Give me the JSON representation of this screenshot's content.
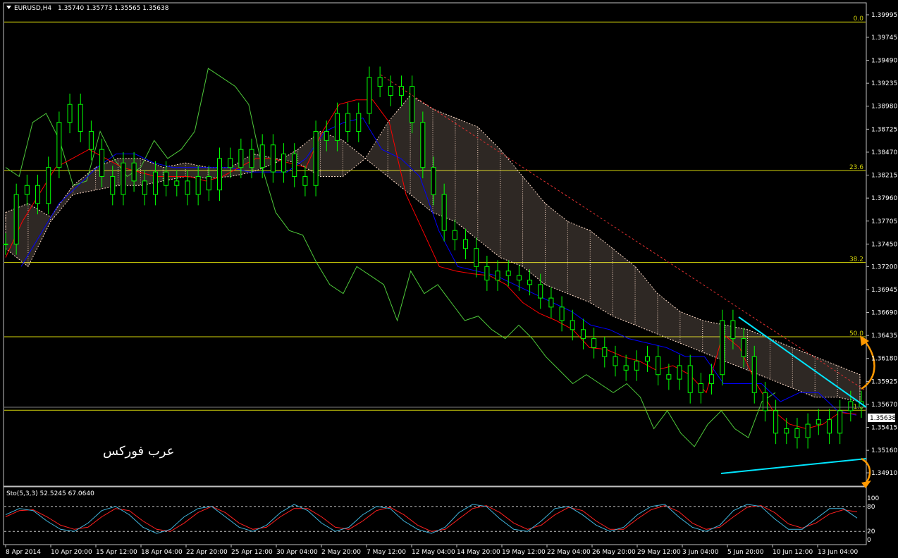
{
  "header": {
    "symbol_timeframe": "EURUSD,H4",
    "ohlc": "1.35740 1.35773 1.35565 1.35638"
  },
  "watermark": "عرب فوركس",
  "current_price_label": "1.35638",
  "colors": {
    "background": "#000000",
    "candles": "#00ff00",
    "tenkan": "#ff0000",
    "kijun": "#0000ff",
    "chikou": "#4ec93a",
    "cloud": "#ffdcc8",
    "fib": "#d4d40a",
    "trendline": "#00e5ff",
    "dashed_trend": "#e03030",
    "arrow": "#ff9900",
    "stoch_main": "#40b4dc",
    "stoch_signal": "#ff2020"
  },
  "chart_data": {
    "type": "line",
    "main_panel": {
      "ylim": [
        1.3477,
        1.4012
      ],
      "y_ticks": [
        "1.39995",
        "1.39745",
        "1.39490",
        "1.39235",
        "1.38980",
        "1.38725",
        "1.38470",
        "1.38215",
        "1.37960",
        "1.37705",
        "1.37450",
        "1.37200",
        "1.36945",
        "1.36690",
        "1.36435",
        "1.36180",
        "1.35925",
        "1.35670",
        "1.35415",
        "1.35160",
        "1.34910"
      ],
      "x_ticks": [
        "8 Apr 2014",
        "10 Apr 20:00",
        "15 Apr 12:00",
        "18 Apr 04:00",
        "22 Apr 20:00",
        "25 Apr 12:00",
        "30 Apr 04:00",
        "2 May 20:00",
        "7 May 12:00",
        "12 May 04:00",
        "14 May 20:00",
        "19 May 12:00",
        "22 May 04:00",
        "26 May 20:00",
        "29 May 12:00",
        "3 Jun 04:00",
        "5 Jun 20:00",
        "10 Jun 12:00",
        "13 Jun 04:00"
      ],
      "fib_levels": [
        {
          "label": "0.0",
          "price": 1.39915
        },
        {
          "label": "23.6",
          "price": 1.38265
        },
        {
          "label": "38.2",
          "price": 1.37245
        },
        {
          "label": "50.0",
          "price": 1.3642
        },
        {
          "label": "61.8",
          "price": 1.35605
        }
      ],
      "close_series": [
        1.3745,
        1.38,
        1.381,
        1.379,
        1.383,
        1.388,
        1.39,
        1.387,
        1.385,
        1.382,
        1.38,
        1.3835,
        1.3815,
        1.38,
        1.3825,
        1.381,
        1.3815,
        1.38,
        1.382,
        1.3805,
        1.384,
        1.383,
        1.385,
        1.383,
        1.3855,
        1.3825,
        1.3845,
        1.382,
        1.381,
        1.387,
        1.386,
        1.389,
        1.387,
        1.389,
        1.393,
        1.392,
        1.391,
        1.392,
        1.388,
        1.383,
        1.38,
        1.376,
        1.375,
        1.374,
        1.372,
        1.3705,
        1.3715,
        1.371,
        1.3705,
        1.37,
        1.3685,
        1.3675,
        1.366,
        1.365,
        1.364,
        1.363,
        1.362,
        1.361,
        1.3605,
        1.3615,
        1.362,
        1.36,
        1.3595,
        1.361,
        1.358,
        1.359,
        1.36,
        1.366,
        1.364,
        1.362,
        1.358,
        1.356,
        1.3535,
        1.354,
        1.353,
        1.3545,
        1.355,
        1.3535,
        1.356,
        1.357,
        1.3564
      ],
      "tenkan_series": [
        1.373,
        1.377,
        1.38,
        1.383,
        1.384,
        1.385,
        1.384,
        1.383,
        1.3825,
        1.382,
        1.382,
        1.382,
        1.3815,
        1.382,
        1.383,
        1.384,
        1.384,
        1.3835,
        1.383,
        1.387,
        1.39,
        1.3905,
        1.3905,
        1.388,
        1.38,
        1.376,
        1.372,
        1.3715,
        1.3712,
        1.371,
        1.37,
        1.368,
        1.3668,
        1.366,
        1.365,
        1.363,
        1.3628,
        1.362,
        1.3615,
        1.3605,
        1.361,
        1.36,
        1.358,
        1.3645,
        1.363,
        1.359,
        1.356,
        1.3545,
        1.354,
        1.3545,
        1.3558,
        1.3556
      ],
      "kijun_series": [
        1.372,
        1.3755,
        1.379,
        1.381,
        1.383,
        1.3845,
        1.3845,
        1.3835,
        1.383,
        1.383,
        1.383,
        1.383,
        1.3825,
        1.3825,
        1.3825,
        1.384,
        1.387,
        1.388,
        1.3885,
        1.385,
        1.384,
        1.382,
        1.376,
        1.372,
        1.3715,
        1.371,
        1.37,
        1.369,
        1.368,
        1.367,
        1.3655,
        1.365,
        1.364,
        1.3635,
        1.363,
        1.362,
        1.362,
        1.359,
        1.359,
        1.359,
        1.357,
        1.358,
        1.358,
        1.356,
        1.3555
      ],
      "chikou_series": [
        1.383,
        1.382,
        1.388,
        1.389,
        1.386,
        1.381,
        1.3815,
        1.387,
        1.384,
        1.382,
        1.383,
        1.386,
        1.384,
        1.385,
        1.387,
        1.394,
        1.393,
        1.392,
        1.39,
        1.383,
        1.378,
        1.376,
        1.3755,
        1.3725,
        1.37,
        1.369,
        1.372,
        1.371,
        1.37,
        1.366,
        1.3715,
        1.369,
        1.37,
        1.368,
        1.366,
        1.3665,
        1.365,
        1.364,
        1.3655,
        1.364,
        1.362,
        1.3605,
        1.359,
        1.36,
        1.359,
        1.358,
        1.359,
        1.3575,
        1.354,
        1.356,
        1.3535,
        1.352,
        1.3545,
        1.356,
        1.354,
        1.353,
        1.357,
        1.358
      ],
      "cloud_top": [
        1.378,
        1.379,
        1.3775,
        1.381,
        1.383,
        1.384,
        1.384,
        1.383,
        1.3835,
        1.383,
        1.383,
        1.3845,
        1.384,
        1.3835,
        1.382,
        1.382,
        1.384,
        1.388,
        1.391,
        1.3895,
        1.3885,
        1.3875,
        1.385,
        1.382,
        1.379,
        1.377,
        1.376,
        1.374,
        1.372,
        1.369,
        1.367,
        1.366,
        1.3655,
        1.365,
        1.364,
        1.363,
        1.362,
        1.361,
        1.36
      ],
      "cloud_bottom": [
        1.374,
        1.372,
        1.377,
        1.38,
        1.3805,
        1.381,
        1.381,
        1.3815,
        1.382,
        1.3818,
        1.382,
        1.3825,
        1.3835,
        1.385,
        1.387,
        1.386,
        1.384,
        1.382,
        1.38,
        1.378,
        1.377,
        1.375,
        1.373,
        1.372,
        1.37,
        1.369,
        1.368,
        1.3665,
        1.3655,
        1.3645,
        1.3635,
        1.3625,
        1.3615,
        1.3605,
        1.3595,
        1.3585,
        1.3575,
        1.3575,
        1.357
      ]
    },
    "stochastic": {
      "header": "Sto(5,3,3) 52.5245 67.0640",
      "ylim": [
        0,
        100
      ],
      "y_ticks": [
        "100",
        "80",
        "20",
        "0"
      ],
      "levels": [
        80,
        20
      ],
      "main": [
        60,
        75,
        70,
        45,
        25,
        20,
        40,
        70,
        80,
        60,
        30,
        15,
        25,
        55,
        75,
        80,
        55,
        30,
        20,
        35,
        65,
        85,
        70,
        40,
        20,
        30,
        60,
        80,
        75,
        45,
        25,
        15,
        30,
        65,
        85,
        80,
        50,
        25,
        20,
        45,
        75,
        80,
        60,
        35,
        20,
        30,
        60,
        80,
        85,
        55,
        30,
        20,
        35,
        70,
        85,
        80,
        50,
        25,
        25,
        50,
        75,
        75,
        52
      ],
      "signal": [
        55,
        70,
        72,
        55,
        35,
        25,
        30,
        55,
        75,
        70,
        45,
        25,
        20,
        40,
        65,
        80,
        65,
        40,
        25,
        30,
        55,
        75,
        75,
        55,
        30,
        25,
        45,
        70,
        78,
        60,
        35,
        20,
        25,
        50,
        75,
        82,
        65,
        40,
        25,
        35,
        60,
        78,
        70,
        45,
        25,
        25,
        50,
        72,
        82,
        68,
        40,
        25,
        30,
        55,
        78,
        82,
        65,
        38,
        28,
        40,
        62,
        72,
        67
      ]
    }
  }
}
